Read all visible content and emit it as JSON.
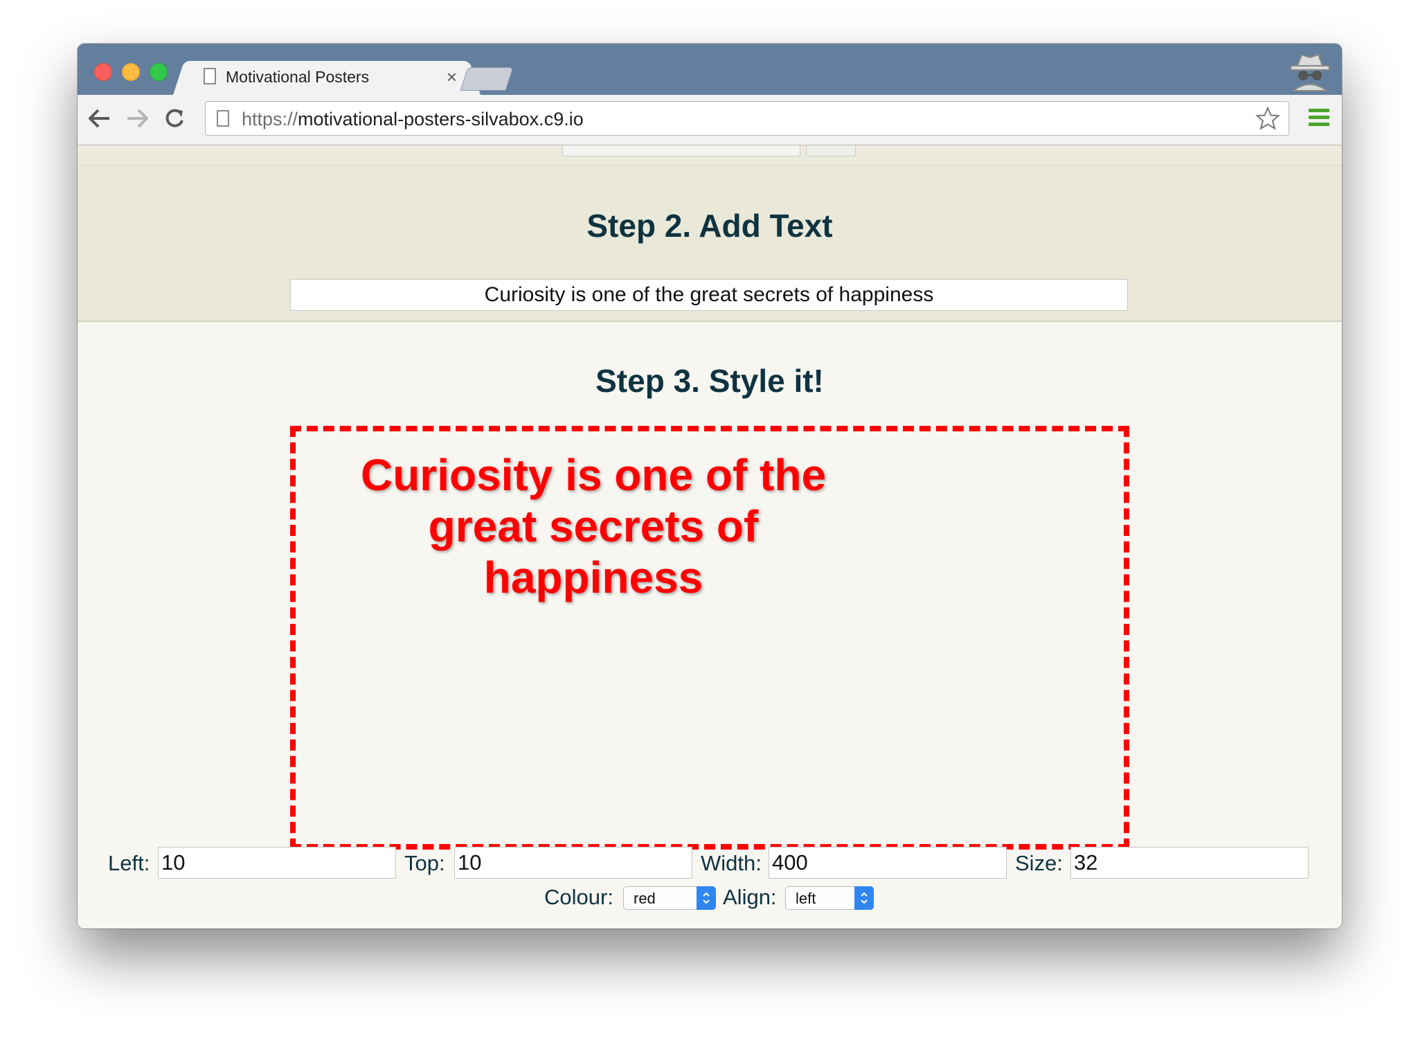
{
  "browser": {
    "tab_title": "Motivational Posters",
    "tab_close": "×",
    "url_scheme": "https://",
    "url_host": "motivational-posters-silvabox.c9.io"
  },
  "step2": {
    "heading": "Step 2. Add Text",
    "text_value": "Curiosity is one of the great secrets of happiness"
  },
  "step3": {
    "heading": "Step 3. Style it!",
    "poster_text": "Curiosity is one of the great secrets of happiness",
    "poster_color": "#ff0000",
    "border_color": "#ff0000"
  },
  "controls": {
    "left_label": "Left:",
    "left_value": "10",
    "top_label": "Top:",
    "top_value": "10",
    "width_label": "Width:",
    "width_value": "400",
    "size_label": "Size:",
    "size_value": "32",
    "colour_label": "Colour:",
    "colour_value": "red",
    "align_label": "Align:",
    "align_value": "left"
  },
  "colors": {
    "heading": "#0f3340",
    "titlebar": "#647f9e",
    "select_accent": "#2f86f0",
    "menu_icon": "#4aa52a"
  }
}
